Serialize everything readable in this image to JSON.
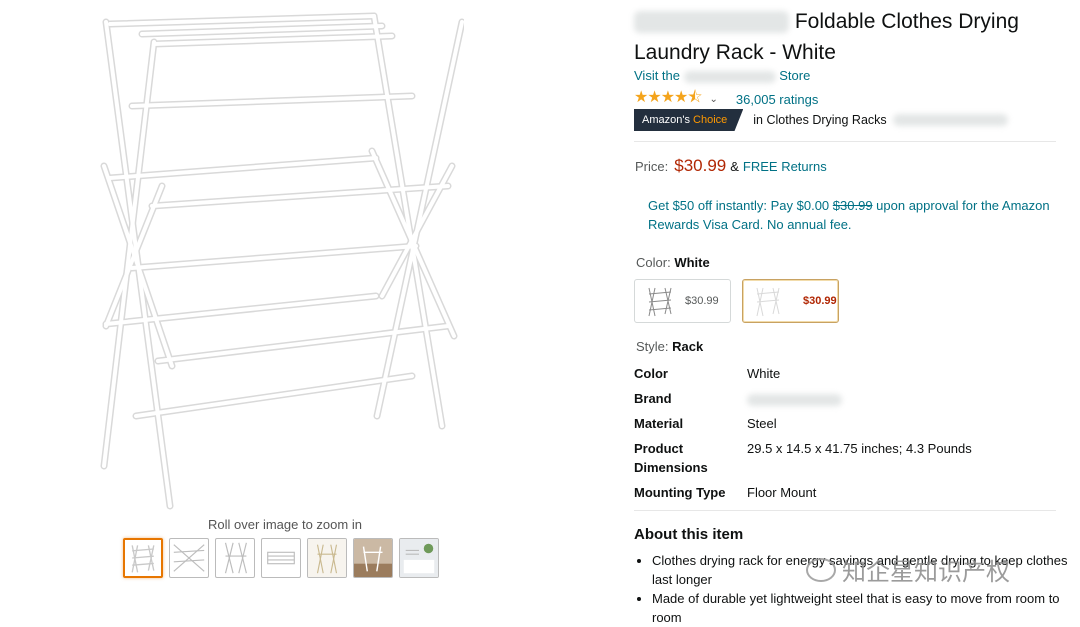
{
  "gallery": {
    "zoom_hint": "Roll over image to zoom in",
    "thumbnail_count": 7,
    "selected_thumbnail": 1
  },
  "product": {
    "title_brand_hidden": true,
    "title": "Foldable Clothes Drying Laundry Rack - White",
    "store_prefix": "Visit the",
    "store_suffix": "Store",
    "rating": 4.5,
    "stars_text": "★★★★⯪",
    "ratings_count": "36,005 ratings",
    "badge_prefix": "Amazon's",
    "badge_highlight": "Choice",
    "badge_category": "in Clothes Drying Racks"
  },
  "pricing": {
    "label": "Price:",
    "price": "$30.99",
    "amp": "&",
    "free_returns": "FREE Returns",
    "promo_part1": "Get $50 off instantly: Pay $0.00",
    "promo_strike": "$30.99",
    "promo_part2": "upon approval for the Amazon Rewards Visa Card. No annual fee."
  },
  "variations": {
    "color_label": "Color:",
    "color_value": "White",
    "swatches": [
      {
        "price": "$30.99"
      },
      {
        "price": "$30.99"
      }
    ],
    "style_label": "Style:",
    "style_value": "Rack"
  },
  "specs": [
    {
      "key": "Color",
      "value": "White"
    },
    {
      "key": "Brand",
      "value": ""
    },
    {
      "key": "Material",
      "value": "Steel"
    },
    {
      "key": "Product Dimensions",
      "value": "29.5 x 14.5 x 41.75 inches; 4.3 Pounds"
    },
    {
      "key": "Mounting Type",
      "value": "Floor Mount"
    }
  ],
  "about": {
    "heading": "About this item",
    "bullets": [
      "Clothes drying rack for energy savings and gentle drying to keep clothes last longer",
      "Made of durable yet lightweight steel that is easy to move from room to room"
    ]
  },
  "watermark": "知企星知识产权",
  "colors": {
    "link": "#007185",
    "price": "#b12704",
    "badge_bg": "#232f3e",
    "badge_accent": "#ff9900",
    "star": "#f4a41c",
    "selected_border": "#e77600"
  }
}
